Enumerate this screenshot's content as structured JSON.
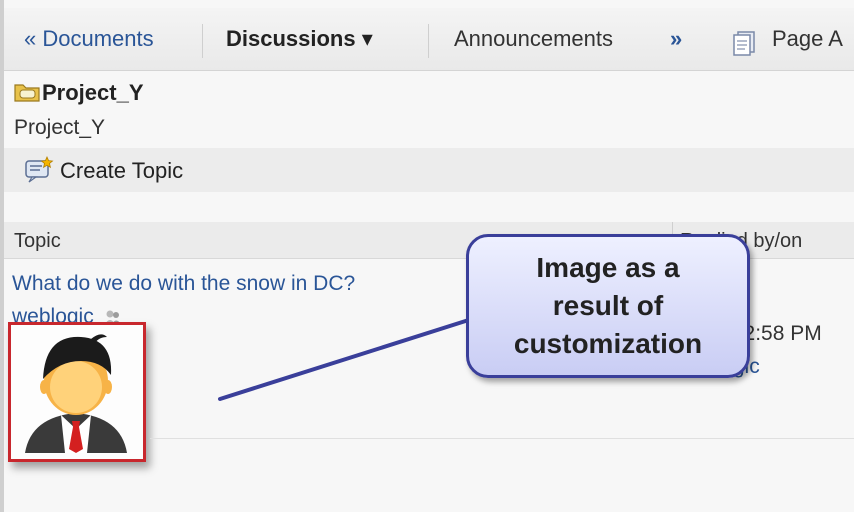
{
  "tabs": {
    "documents": "« Documents",
    "discussions": "Discussions ▾",
    "announcements": "Announcements",
    "more": "»",
    "page_actions": "Page A"
  },
  "folder": {
    "title": "Project_Y",
    "subtitle": "Project_Y"
  },
  "toolbar": {
    "create_topic": "Create Topic"
  },
  "table": {
    "col_topic": "Topic",
    "col_replied": "Replied by/on",
    "row": {
      "topic": "What do we do with the snow in DC?",
      "author": "weblogic",
      "replied_time": "0 2:58 PM",
      "replied_author": "weblogic"
    }
  },
  "callout": {
    "line1": "Image as a",
    "line2": "result of",
    "line3": "customization"
  },
  "colors": {
    "link": "#2a5597",
    "highlight_border": "#c8272d",
    "callout_border": "#3a3f9a"
  },
  "icons": {
    "folder": "folder-icon",
    "create_topic": "create-topic-icon",
    "presence": "presence-icon",
    "page": "page-icon",
    "avatar": "user-avatar"
  }
}
